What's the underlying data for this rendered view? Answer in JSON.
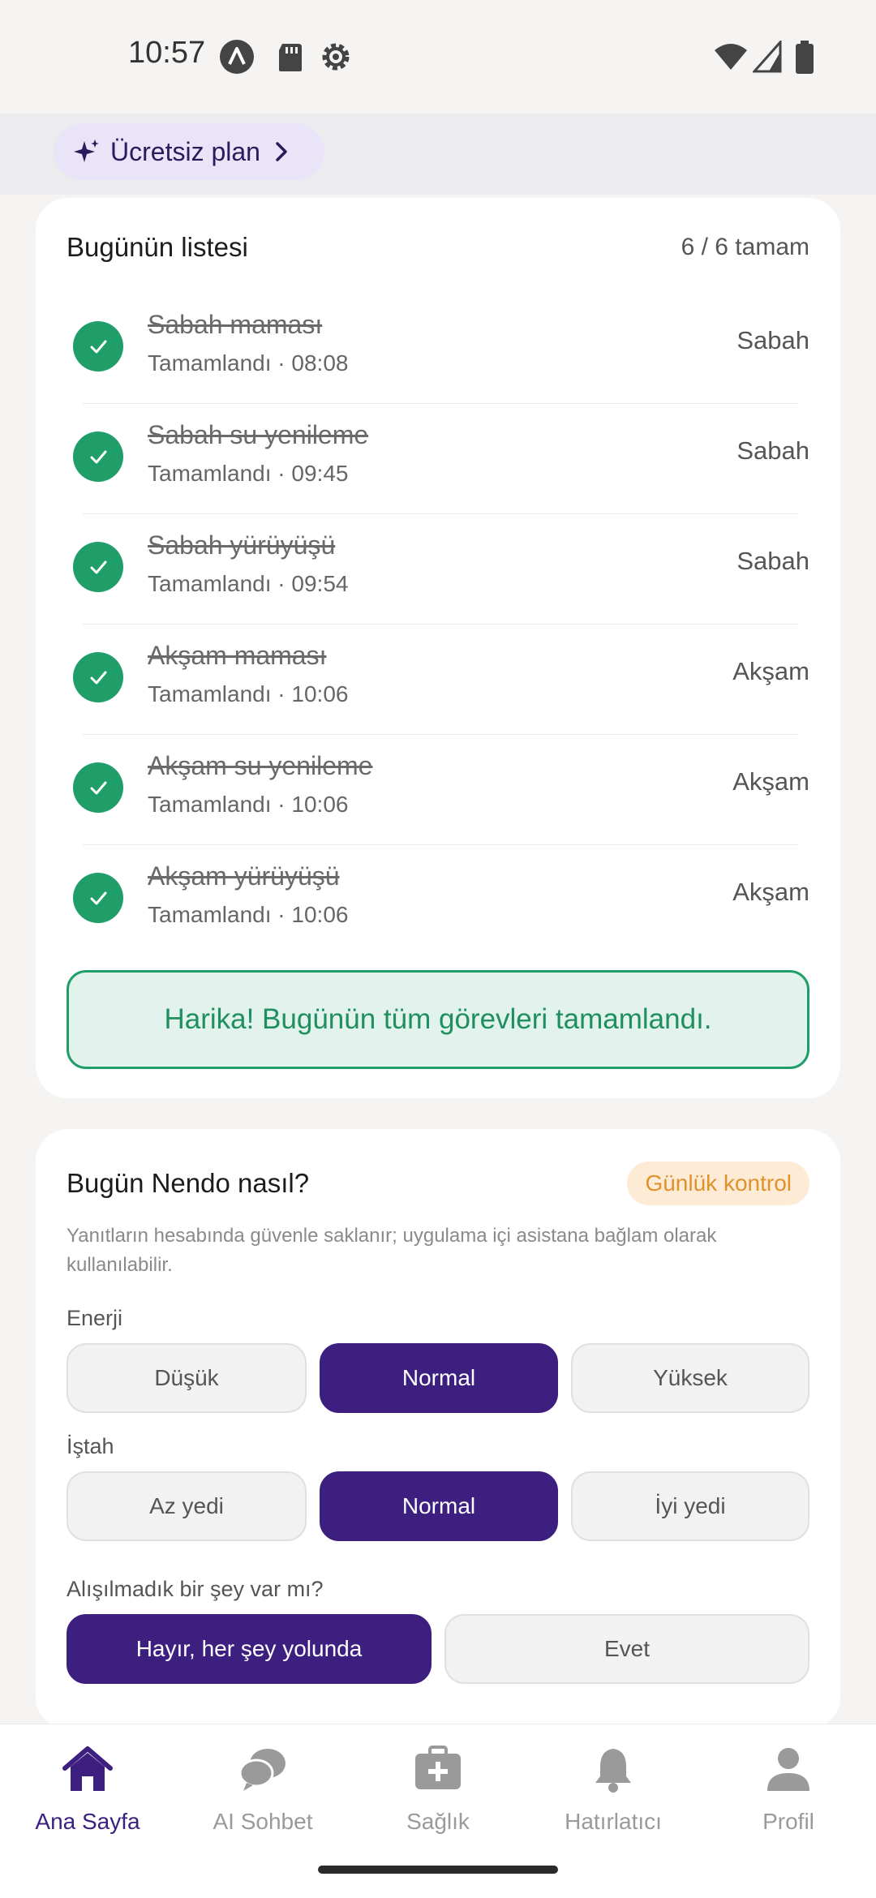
{
  "status_bar": {
    "time": "10:57",
    "icons_left": [
      "a11y-icon",
      "sd-card-icon",
      "settings-icon"
    ],
    "icons_right": [
      "wifi-icon",
      "signal-icon",
      "battery-icon"
    ]
  },
  "plan_chip": {
    "label": "Ücretsiz plan",
    "icon": "sparkle-icon"
  },
  "today_list": {
    "title": "Bugünün listesi",
    "progress": "6 / 6 tamam",
    "tasks": [
      {
        "name": "Sabah maması",
        "sub": "Tamamlandı · 08:08",
        "when": "Sabah"
      },
      {
        "name": "Sabah su yenileme",
        "sub": "Tamamlandı · 09:45",
        "when": "Sabah"
      },
      {
        "name": "Sabah yürüyüşü",
        "sub": "Tamamlandı · 09:54",
        "when": "Sabah"
      },
      {
        "name": "Akşam maması",
        "sub": "Tamamlandı · 10:06",
        "when": "Akşam"
      },
      {
        "name": "Akşam su yenileme",
        "sub": "Tamamlandı · 10:06",
        "when": "Akşam"
      },
      {
        "name": "Akşam yürüyüşü",
        "sub": "Tamamlandı · 10:06",
        "when": "Akşam"
      }
    ],
    "success_message": "Harika! Bugünün tüm görevleri tamamlandı."
  },
  "daily_check": {
    "title": "Bugün Nendo nasıl?",
    "badge": "Günlük kontrol",
    "hint": "Yanıtların hesabında güvenle saklanır; uygulama içi asistana bağlam olarak kullanılabilir.",
    "energy": {
      "label": "Enerji",
      "options": [
        "Düşük",
        "Normal",
        "Yüksek"
      ],
      "selected": "Normal"
    },
    "appetite": {
      "label": "İştah",
      "options": [
        "Az yedi",
        "Normal",
        "İyi yedi"
      ],
      "selected": "Normal"
    },
    "unusual": {
      "label": "Alışılmadık bir şey var mı?",
      "options": [
        "Hayır, her şey yolunda",
        "Evet"
      ],
      "selected": "Hayır, her şey yolunda"
    }
  },
  "bottom_nav": {
    "items": [
      {
        "label": "Ana Sayfa",
        "icon": "home-icon",
        "active": true
      },
      {
        "label": "AI Sohbet",
        "icon": "chat-icon",
        "active": false
      },
      {
        "label": "Sağlık",
        "icon": "medical-kit-icon",
        "active": false
      },
      {
        "label": "Hatırlatıcı",
        "icon": "bell-icon",
        "active": false
      },
      {
        "label": "Profil",
        "icon": "profile-icon",
        "active": false
      }
    ]
  },
  "colors": {
    "accent": "#3d1f7f",
    "success": "#1f9e6a",
    "badge_text": "#e0922a",
    "badge_bg": "#fdebd6"
  }
}
